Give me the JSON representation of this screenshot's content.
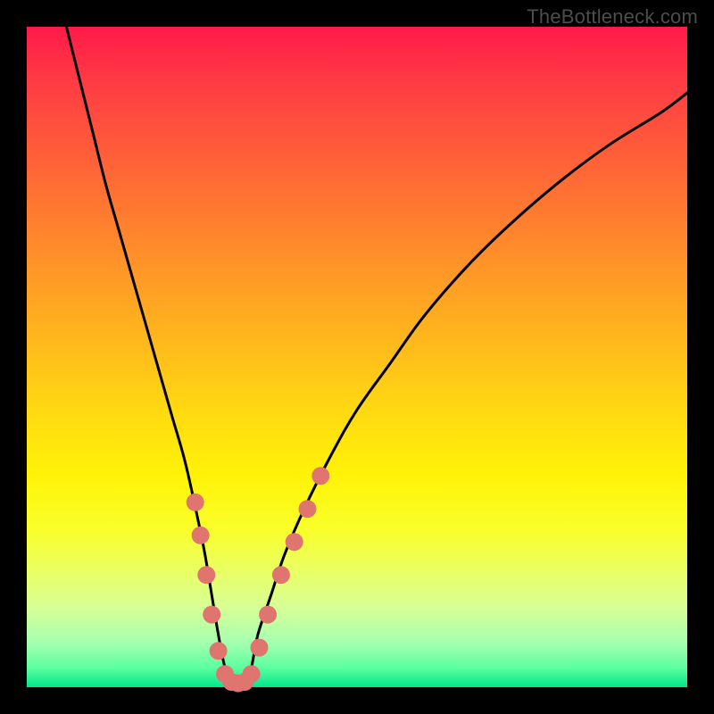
{
  "watermark": "TheBottleneck.com",
  "colors": {
    "frame": "#000000",
    "gradient_top": "#ff1a49",
    "gradient_bottom": "#00e68a",
    "curve": "#000000",
    "marker": "#e0746e"
  },
  "chart_data": {
    "type": "line",
    "title": "",
    "xlabel": "",
    "ylabel": "",
    "xlim": [
      0,
      100
    ],
    "ylim": [
      0,
      100
    ],
    "series": [
      {
        "name": "bottleneck-curve",
        "x": [
          6,
          8,
          10,
          12,
          14,
          16,
          18,
          20,
          22,
          24,
          26,
          27,
          28,
          29,
          30,
          31,
          32,
          33,
          34,
          35,
          37,
          39,
          42,
          46,
          50,
          55,
          60,
          66,
          72,
          80,
          88,
          96,
          100
        ],
        "y": [
          100,
          92,
          84,
          76,
          69,
          62,
          55,
          48,
          41,
          34,
          25,
          20,
          14,
          8,
          3,
          0.8,
          0.5,
          0.8,
          3,
          8,
          14,
          20,
          27,
          35,
          42,
          49,
          56,
          63,
          69,
          76,
          82,
          87,
          90
        ]
      }
    ],
    "markers": {
      "name": "highlighted-points",
      "color": "#e0746e",
      "radius_pct": 1.35,
      "points": [
        {
          "x": 25.5,
          "y": 28
        },
        {
          "x": 26.3,
          "y": 23
        },
        {
          "x": 27.2,
          "y": 17
        },
        {
          "x": 28.0,
          "y": 11
        },
        {
          "x": 29.0,
          "y": 5.5
        },
        {
          "x": 30.0,
          "y": 2.0
        },
        {
          "x": 31.0,
          "y": 0.8
        },
        {
          "x": 32.0,
          "y": 0.6
        },
        {
          "x": 33.0,
          "y": 0.8
        },
        {
          "x": 34.0,
          "y": 2.0
        },
        {
          "x": 35.2,
          "y": 6.0
        },
        {
          "x": 36.5,
          "y": 11
        },
        {
          "x": 38.5,
          "y": 17
        },
        {
          "x": 40.5,
          "y": 22
        },
        {
          "x": 42.5,
          "y": 27
        },
        {
          "x": 44.5,
          "y": 32
        }
      ]
    }
  }
}
